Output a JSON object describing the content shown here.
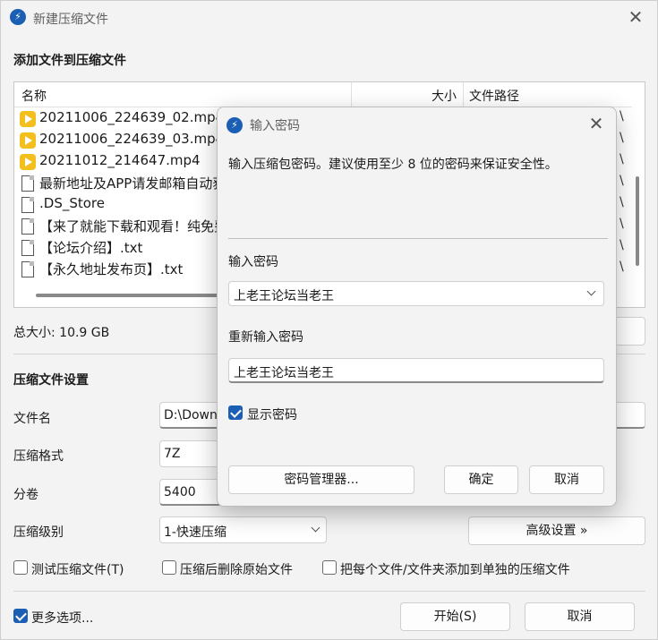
{
  "main": {
    "title": "新建压缩文件",
    "app_icon": "bolt-icon",
    "add_section_title": "添加文件到压缩文件",
    "columns": {
      "name": "名称",
      "size": "大小",
      "path": "文件路径"
    },
    "files": [
      {
        "name": "20211006_224639_02.mp4",
        "icon": "video-file-icon",
        "path": "\\"
      },
      {
        "name": "20211006_224639_03.mp4",
        "icon": "video-file-icon",
        "path": "\\"
      },
      {
        "name": "20211012_214647.mp4",
        "icon": "video-file-icon",
        "path": "\\"
      },
      {
        "name": "最新地址及APP请发邮箱自动获",
        "icon": "document-icon",
        "path": "\\"
      },
      {
        "name": ".DS_Store",
        "icon": "document-icon",
        "path": "\\"
      },
      {
        "name": "【来了就能下载和观看！纯免费",
        "icon": "document-icon",
        "path": "\\"
      },
      {
        "name": "【论坛介绍】.txt",
        "icon": "document-icon",
        "path": "\\"
      },
      {
        "name": "【永久地址发布页】.txt",
        "icon": "document-icon",
        "path": "\\"
      }
    ],
    "total_size": "总大小: 10.9 GB",
    "settings_title": "压缩文件设置",
    "filename_label": "文件名",
    "filename_value": "D:\\Down",
    "format_label": "压缩格式",
    "format_value": "7Z",
    "split_label": "分卷",
    "split_value": "5400",
    "level_label": "压缩级别",
    "level_value": "1-快速压缩",
    "advanced_button": "高级设置 »",
    "options": {
      "test_label": "测试压缩文件(T)",
      "delete_label": "压缩后删除原始文件",
      "separate_label": "把每个文件/文件夹添加到单独的压缩文件"
    },
    "more_options_label": "更多选项...",
    "start_button": "开始(S)",
    "cancel_button": "取消"
  },
  "dialog": {
    "title": "输入密码",
    "hint": "输入压缩包密码。建议使用至少 8 位的密码来保证安全性。",
    "password_label": "输入密码",
    "password_value": "上老王论坛当老王",
    "repeat_label": "重新输入密码",
    "repeat_value": "上老王论坛当老王",
    "show_password_label": "显示密码",
    "show_password_checked": true,
    "manager_button": "密码管理器...",
    "ok_button": "确定",
    "cancel_button": "取消"
  },
  "colors": {
    "accent": "#1a5fb4",
    "video_icon": "#f2bf1c"
  }
}
